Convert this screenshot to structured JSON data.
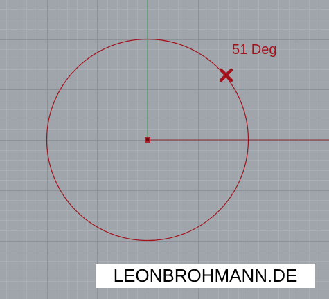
{
  "viewport": {
    "background_color": "#9fa5ab",
    "grid_minor_color": "#a9afb5",
    "grid_major_color": "#8c9298",
    "x_axis_color": "#8a2f35",
    "y_axis_color": "#3f9c4f"
  },
  "geometry": {
    "curve_color": "#a3121b",
    "angle_label": "51 Deg",
    "center_marker_icon": "square-point-icon",
    "point_marker_icon": "x-cross-icon"
  },
  "watermark": {
    "text": "LEONBROHMANN.DE"
  }
}
